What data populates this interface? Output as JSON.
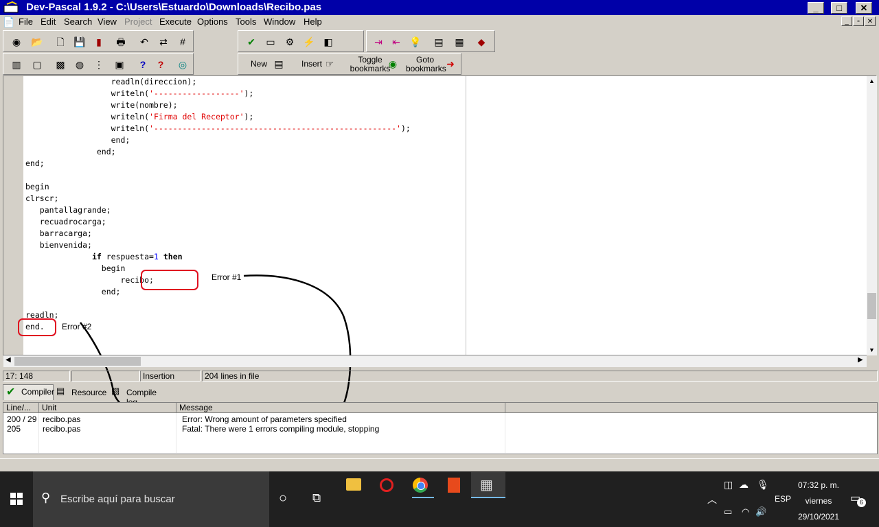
{
  "window": {
    "title": "Dev-Pascal 1.9.2 - C:\\Users\\Estuardo\\Downloads\\Recibo.pas",
    "minimize": "_",
    "maximize": "□",
    "close": "✕"
  },
  "menu": {
    "items": [
      "File",
      "Edit",
      "Search",
      "View",
      "Project",
      "Execute",
      "Options",
      "Tools",
      "Window",
      "Help"
    ],
    "disabled": [
      "Project"
    ]
  },
  "toolbar": {
    "new_label": "New",
    "insert_label": "Insert",
    "toggle_label_1": "Toggle",
    "toggle_label_2": "bookmarks",
    "goto_label_1": "Goto",
    "goto_label_2": "bookmarks"
  },
  "editor": {
    "lines": [
      {
        "indent": "                  ",
        "parts": [
          [
            "readln(direccion);",
            ""
          ]
        ]
      },
      {
        "indent": "                  ",
        "parts": [
          [
            "writeln(",
            ""
          ],
          [
            "'------------------'",
            "str"
          ],
          [
            ");",
            ""
          ]
        ]
      },
      {
        "indent": "                  ",
        "parts": [
          [
            "write(nombre);",
            ""
          ]
        ]
      },
      {
        "indent": "                  ",
        "parts": [
          [
            "writeln(",
            ""
          ],
          [
            "'Firma del Receptor'",
            "str"
          ],
          [
            ");",
            ""
          ]
        ]
      },
      {
        "indent": "                  ",
        "parts": [
          [
            "writeln(",
            ""
          ],
          [
            "'---------------------------------------------------'",
            "str"
          ],
          [
            ");",
            ""
          ]
        ]
      },
      {
        "indent": "                  ",
        "parts": [
          [
            "end;",
            ""
          ]
        ]
      },
      {
        "indent": "               ",
        "parts": [
          [
            "end;",
            ""
          ]
        ]
      },
      {
        "indent": "",
        "parts": [
          [
            "end;",
            ""
          ]
        ]
      },
      {
        "indent": "",
        "parts": []
      },
      {
        "indent": "",
        "parts": [
          [
            "begin",
            ""
          ]
        ]
      },
      {
        "indent": "",
        "parts": [
          [
            "clrscr;",
            ""
          ]
        ]
      },
      {
        "indent": "   ",
        "parts": [
          [
            "pantallagrande;",
            ""
          ]
        ]
      },
      {
        "indent": "   ",
        "parts": [
          [
            "recuadrocarga;",
            ""
          ]
        ]
      },
      {
        "indent": "   ",
        "parts": [
          [
            "barracarga;",
            ""
          ]
        ]
      },
      {
        "indent": "   ",
        "parts": [
          [
            "bienvenida;",
            ""
          ]
        ]
      },
      {
        "indent": "              ",
        "parts": [
          [
            "if",
            "kw"
          ],
          [
            " respuesta=",
            ""
          ],
          [
            "1",
            "num"
          ],
          [
            " ",
            ""
          ],
          [
            "then",
            "kw"
          ]
        ]
      },
      {
        "indent": "                ",
        "parts": [
          [
            "begin",
            ""
          ]
        ]
      },
      {
        "indent": "                    ",
        "parts": [
          [
            "recibo;",
            ""
          ]
        ]
      },
      {
        "indent": "                ",
        "parts": [
          [
            "end;",
            ""
          ]
        ]
      },
      {
        "indent": "",
        "parts": []
      },
      {
        "indent": "",
        "parts": [
          [
            "readln;",
            ""
          ]
        ]
      },
      {
        "indent": "",
        "parts": [
          [
            "end.",
            ""
          ]
        ]
      }
    ],
    "annotation_1": "Error #1",
    "annotation_2": "Error #2"
  },
  "status": {
    "position": "17: 148",
    "empty": "",
    "mode": "Insertion",
    "lines_info": "204 lines in file"
  },
  "tabs": [
    "Compiler",
    "Resource",
    "Compile log"
  ],
  "messages": {
    "columns": [
      "Line/...",
      "Unit",
      "Message"
    ],
    "rows": [
      {
        "line": "200 / 29",
        "unit": "recibo.pas",
        "message": "Error: Wrong amount of parameters specified"
      },
      {
        "line": "205",
        "unit": "recibo.pas",
        "message": "Fatal: There were 1 errors compiling module, stopping"
      }
    ]
  },
  "taskbar": {
    "search_placeholder": "Escribe aquí para buscar",
    "language": "ESP",
    "time": "07:32 p. m.",
    "day": "viernes",
    "date": "29/10/2021",
    "notifications": "6"
  }
}
